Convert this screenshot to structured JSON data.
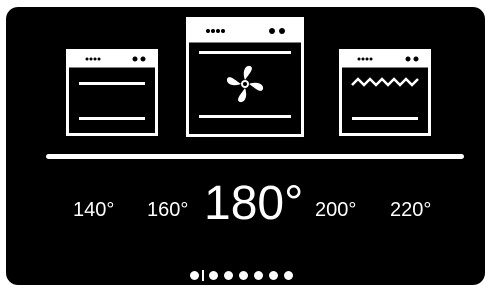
{
  "modes": [
    {
      "name": "conventional-oven",
      "selected": false
    },
    {
      "name": "fan-oven",
      "selected": true
    },
    {
      "name": "grill-oven",
      "selected": false
    }
  ],
  "temperature": {
    "options": [
      "140°",
      "160°",
      "180°",
      "200°",
      "220°"
    ],
    "selected": "180°"
  },
  "pager": {
    "total_pages": 7,
    "current_page": 1
  },
  "colors": {
    "background": "#000000",
    "foreground": "#ffffff"
  }
}
